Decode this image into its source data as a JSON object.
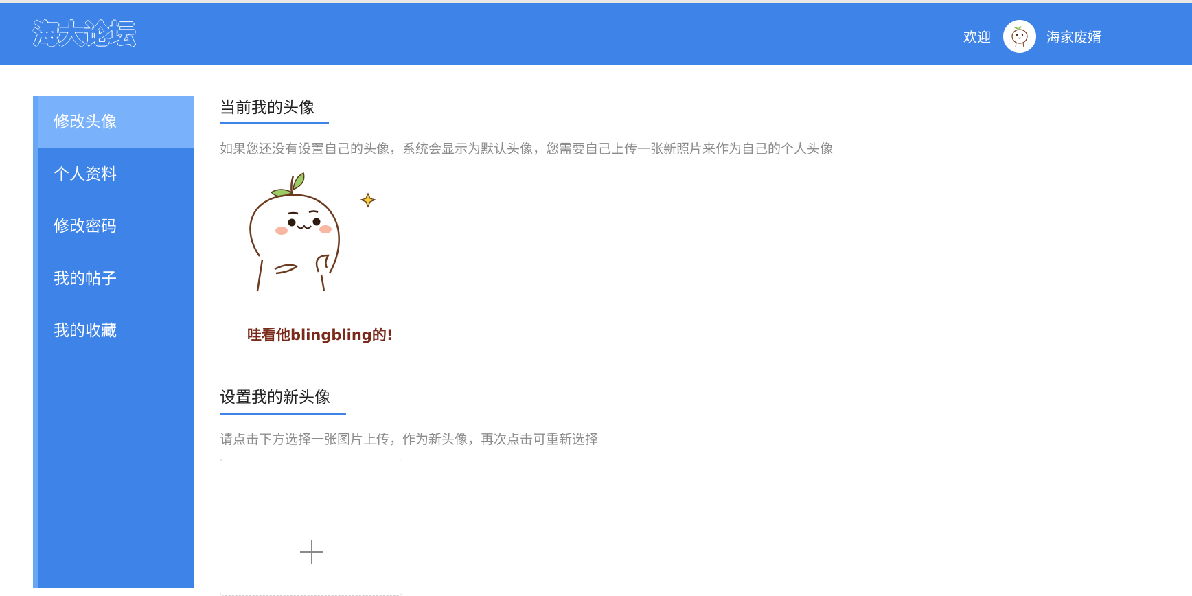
{
  "header": {
    "logo": "海大论坛",
    "welcome": "欢迎",
    "username": "海家废婿",
    "bg_color": "#3e84e8"
  },
  "sidebar": {
    "items": [
      {
        "label": "修改头像",
        "active": true
      },
      {
        "label": "个人资料"
      },
      {
        "label": "修改密码"
      },
      {
        "label": "我的帖子"
      },
      {
        "label": "我的收藏"
      }
    ]
  },
  "main": {
    "current": {
      "title": "当前我的头像",
      "description": "如果您还没有设置自己的头像，系统会显示为默认头像，您需要自己上传一张新照片来作为自己的个人头像",
      "avatar_caption": "哇看他blingbling的!"
    },
    "upload": {
      "title": "设置我的新头像",
      "description": "请点击下方选择一张图片上传，作为新头像，再次点击可重新选择",
      "icon": "plus-icon"
    }
  }
}
